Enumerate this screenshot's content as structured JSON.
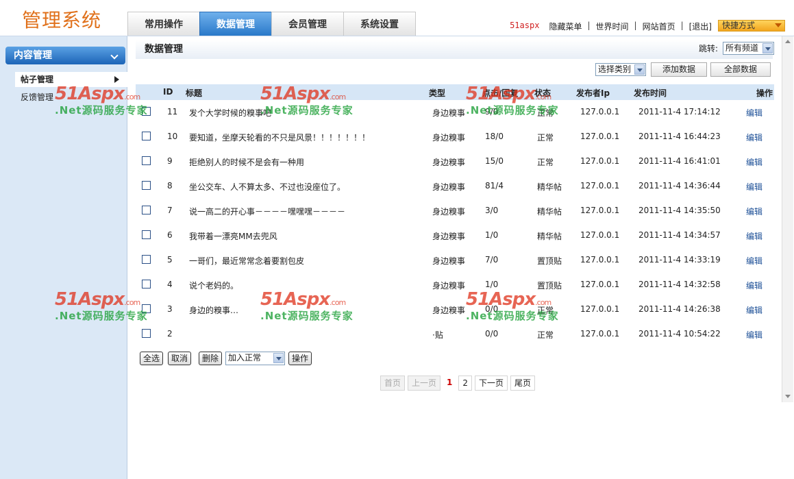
{
  "app": {
    "title": "管理系统"
  },
  "tabs": [
    {
      "label": "常用操作",
      "active": false
    },
    {
      "label": "数据管理",
      "active": true
    },
    {
      "label": "会员管理",
      "active": false
    },
    {
      "label": "系统设置",
      "active": false
    }
  ],
  "toplinks": {
    "brand": "51aspx",
    "hide_menu": "隐藏菜单",
    "world_time": "世界时间",
    "home": "网站首页",
    "logout": "[退出]",
    "sep": "|"
  },
  "quick": {
    "label": "快捷方式"
  },
  "sidebar": {
    "header": "内容管理",
    "items": [
      {
        "label": "帖子管理",
        "active": true
      },
      {
        "label": "反馈管理",
        "active": false
      }
    ]
  },
  "main": {
    "title": "数据管理",
    "jump_label": "跳转:",
    "jump_select": "所有频道",
    "category_select": "选择类别",
    "add_button": "添加数据",
    "all_button": "全部数据"
  },
  "table": {
    "headers": {
      "id": "ID",
      "title": "标题",
      "type": "类型",
      "clicks": "点击/回复",
      "status": "状态",
      "ip": "发布者Ip",
      "time": "发布时间",
      "op": "操作"
    },
    "rows": [
      {
        "id": "11",
        "title": "发个大学时候的糗事吧",
        "type": "身边糗事",
        "clicks": "9/0",
        "status": "正常",
        "ip": "127.0.0.1",
        "time": "2011-11-4 17:14:12",
        "op": "编辑"
      },
      {
        "id": "10",
        "title": "要知道，坐摩天轮看的不只是风景！！！！！！！",
        "type": "身边糗事",
        "clicks": "18/0",
        "status": "正常",
        "ip": "127.0.0.1",
        "time": "2011-11-4 16:44:23",
        "op": "编辑"
      },
      {
        "id": "9",
        "title": "拒绝别人的时候不是会有一种用",
        "type": "身边糗事",
        "clicks": "15/0",
        "status": "正常",
        "ip": "127.0.0.1",
        "time": "2011-11-4 16:41:01",
        "op": "编辑"
      },
      {
        "id": "8",
        "title": "坐公交车、人不算太多、不过也没座位了。",
        "type": "身边糗事",
        "clicks": "81/4",
        "status": "精华帖",
        "ip": "127.0.0.1",
        "time": "2011-11-4 14:36:44",
        "op": "编辑"
      },
      {
        "id": "7",
        "title": "说一高二的开心事－－－－嘿嘿嘿－－－－",
        "type": "身边糗事",
        "clicks": "3/0",
        "status": "精华帖",
        "ip": "127.0.0.1",
        "time": "2011-11-4 14:35:50",
        "op": "编辑"
      },
      {
        "id": "6",
        "title": "我带着一漂亮MM去兜风",
        "type": "身边糗事",
        "clicks": "1/0",
        "status": "精华帖",
        "ip": "127.0.0.1",
        "time": "2011-11-4 14:34:57",
        "op": "编辑"
      },
      {
        "id": "5",
        "title": "一哥们，最近常常念着要割包皮",
        "type": "身边糗事",
        "clicks": "7/0",
        "status": "置顶贴",
        "ip": "127.0.0.1",
        "time": "2011-11-4 14:33:19",
        "op": "编辑"
      },
      {
        "id": "4",
        "title": "说个老妈的。",
        "type": "身边糗事",
        "clicks": "1/0",
        "status": "置顶贴",
        "ip": "127.0.0.1",
        "time": "2011-11-4 14:32:58",
        "op": "编辑"
      },
      {
        "id": "3",
        "title": "身边的糗事…",
        "type": "身边糗事",
        "clicks": "0/0",
        "status": "正常",
        "ip": "127.0.0.1",
        "time": "2011-11-4 14:26:38",
        "op": "编辑"
      },
      {
        "id": "2",
        "title": "",
        "type": "·贴",
        "clicks": "0/0",
        "status": "正常",
        "ip": "127.0.0.1",
        "time": "2011-11-4 10:54:22",
        "op": "编辑"
      }
    ]
  },
  "actions": {
    "select_all": "全选",
    "cancel": "取消",
    "delete": "删除",
    "op_select": "加入正常",
    "operate": "操作"
  },
  "pager": {
    "first": "首页",
    "prev": "上一页",
    "page1": "1",
    "page2": "2",
    "next": "下一页",
    "last": "尾页"
  },
  "watermark": {
    "logo": "51Aspx",
    "suffix": ".com",
    "slogan": ".Net源码服务专家"
  },
  "colors": {
    "accent": "#2a79c9",
    "logo": "#e0701a",
    "link": "#1b4e96"
  }
}
